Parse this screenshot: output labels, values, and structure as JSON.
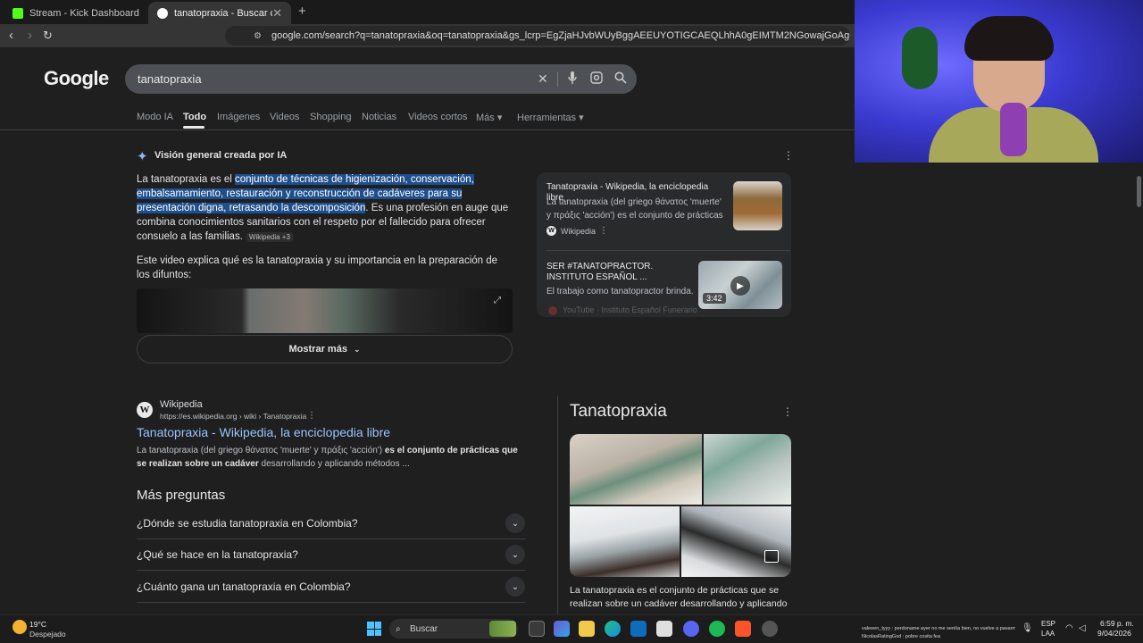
{
  "browser": {
    "tabs": [
      {
        "label": "Stream - Kick Dashboard"
      },
      {
        "label": "tanatopraxia - Buscar con Google"
      }
    ],
    "url": "google.com/search?q=tanatopraxia&oq=tanatopraxia&gs_lcrp=EgZjaHJvbWUyBggAEEUYOTIGCAEQLhhA0gEIMTM2NGowajGoAgCwAgA&sourceid..."
  },
  "google": {
    "logo": "Google",
    "query": "tanatopraxia",
    "tabs": [
      "Modo IA",
      "Todo",
      "Imágenes",
      "Videos",
      "Shopping",
      "Noticias",
      "Videos cortos",
      "Más ▾",
      "Herramientas ▾"
    ]
  },
  "ai_overview": {
    "title": "Visión general creada por IA",
    "p1_start": "La tanatopraxia es el ",
    "p1_highlight": "conjunto de técnicas de higienización, conservación, embalsamamiento, restauración y reconstrucción de cadáveres para su presentación digna, retrasando la descomposición",
    "p1_end": ". Es una profesión en auge que combina conocimientos sanitarios con el respeto por el fallecido para ofrecer consuelo a las familias.",
    "p1_cite": "Wikipedia +3",
    "p2": "Este video explica qué es la tanatopraxia y su importancia en la preparación de los difuntos:",
    "show_more": "Mostrar más",
    "sources": [
      {
        "title": "Tanatopraxia - Wikipedia, la enciclopedia libre",
        "snippet": "La tanatopraxia (del griego θάνατος 'muerte' y πράξις 'acción') es el conjunto de prácticas qu...",
        "site": "Wikipedia"
      },
      {
        "title": "SER #TANATOPRACTOR. INSTITUTO ESPAÑOL ...",
        "snippet": "El trabajo como tanatopractor brinda...",
        "site": "YouTube · Instituto Español Funerario",
        "duration": "3:42"
      }
    ]
  },
  "result": {
    "site": "Wikipedia",
    "url": "https://es.wikipedia.org › wiki › Tanatopraxia",
    "title": "Tanatopraxia - Wikipedia, la enciclopedia libre",
    "snippet_start": "La tanatopraxia (del griego θάνατος 'muerte' y πράξις 'acción') ",
    "snippet_bold": "es el conjunto de prácticas que se realizan sobre un cadáver",
    "snippet_end": " desarrollando y aplicando métodos ..."
  },
  "people_also_ask": {
    "title": "Más preguntas",
    "questions": [
      "¿Dónde se estudia tanatopraxia en Colombia?",
      "¿Qué se hace en la tanatopraxia?",
      "¿Cuánto gana un tanatopraxia en Colombia?"
    ]
  },
  "knowledge_panel": {
    "title": "Tanatopraxia",
    "description": "La tanatopraxia es el conjunto de prácticas que se realizan sobre un cadáver desarrollando y aplicando"
  },
  "taskbar": {
    "temp": "19°C",
    "weather": "Despejado",
    "search": "Buscar",
    "chat1": "valeeen_tyyy : perdoname ayer no me sentía bien, no vuelve a pasarrr",
    "chat2": "NicolasRatingGod : pobre cosita fea",
    "lang1": "ESP",
    "lang2": "LAA",
    "time": "6:59 p. m.",
    "date": "9/04/2026"
  }
}
